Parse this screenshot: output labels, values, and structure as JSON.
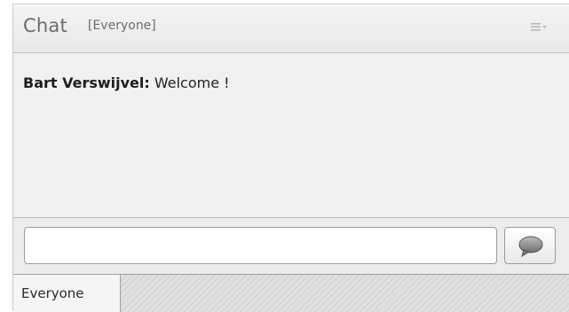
{
  "header": {
    "title": "Chat",
    "scope": "[Everyone]",
    "menu_icon": "options-menu-icon"
  },
  "messages": [
    {
      "sender": "Bart Verswijvel:",
      "text": " Welcome !"
    }
  ],
  "composer": {
    "input_value": "",
    "send_icon": "speech-bubble-icon"
  },
  "tabs": [
    {
      "label": "Everyone",
      "selected": true
    }
  ],
  "colors": {
    "header_text": "#6b6b6b",
    "background": "#f1f1f1"
  }
}
